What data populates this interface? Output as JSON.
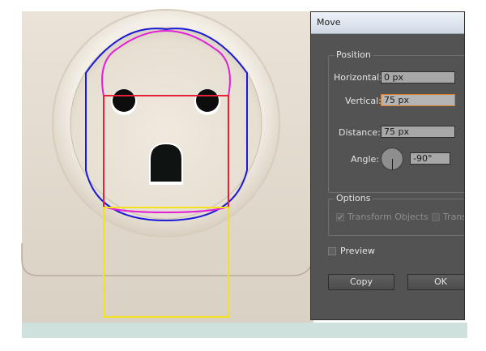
{
  "dialog": {
    "title": "Move",
    "position": {
      "legend": "Position",
      "horizontal_label": "Horizontal:",
      "horizontal_value": "0 px",
      "vertical_label": "Vertical:",
      "vertical_value": "75 px",
      "distance_label": "Distance:",
      "distance_value": "75 px",
      "angle_label": "Angle:",
      "angle_value": "-90°"
    },
    "options": {
      "legend": "Options",
      "transform_objects_label": "Transform Objects",
      "transform_objects_checked": true,
      "transform_patterns_label": "Trans"
    },
    "preview_label": "Preview",
    "copy_label": "Copy",
    "ok_label": "OK"
  },
  "colors": {
    "selection_blue": "#1a1ad8",
    "selection_magenta": "#e021d6",
    "selection_red": "#e8213a",
    "selection_yellow": "#f3e21d",
    "dialog_bg": "#535353",
    "field_focus": "#e07a23"
  }
}
